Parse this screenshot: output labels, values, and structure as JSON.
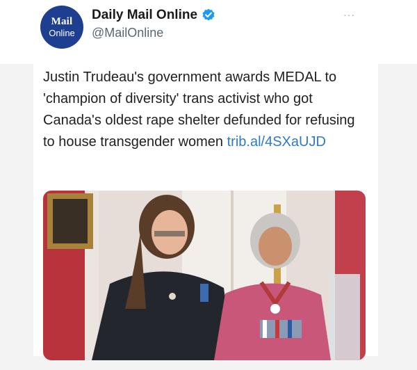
{
  "account": {
    "avatar_line1": "Mail",
    "avatar_line2": "Online",
    "display_name": "Daily Mail Online",
    "handle": "@MailOnline"
  },
  "more_label": "···",
  "tweet": {
    "text": "Justin Trudeau's government awards MEDAL to 'champion of diversity' trans activist who got Canada's oldest rape shelter defunded for refusing to house transgender women",
    "link": "trib.al/4SXaUJD"
  },
  "colors": {
    "verified": "#1d9bf0",
    "avatar_bg": "#1e3f8f",
    "link": "#2b7bc9"
  },
  "icons": [
    "verified-badge-icon",
    "more-options-icon"
  ]
}
